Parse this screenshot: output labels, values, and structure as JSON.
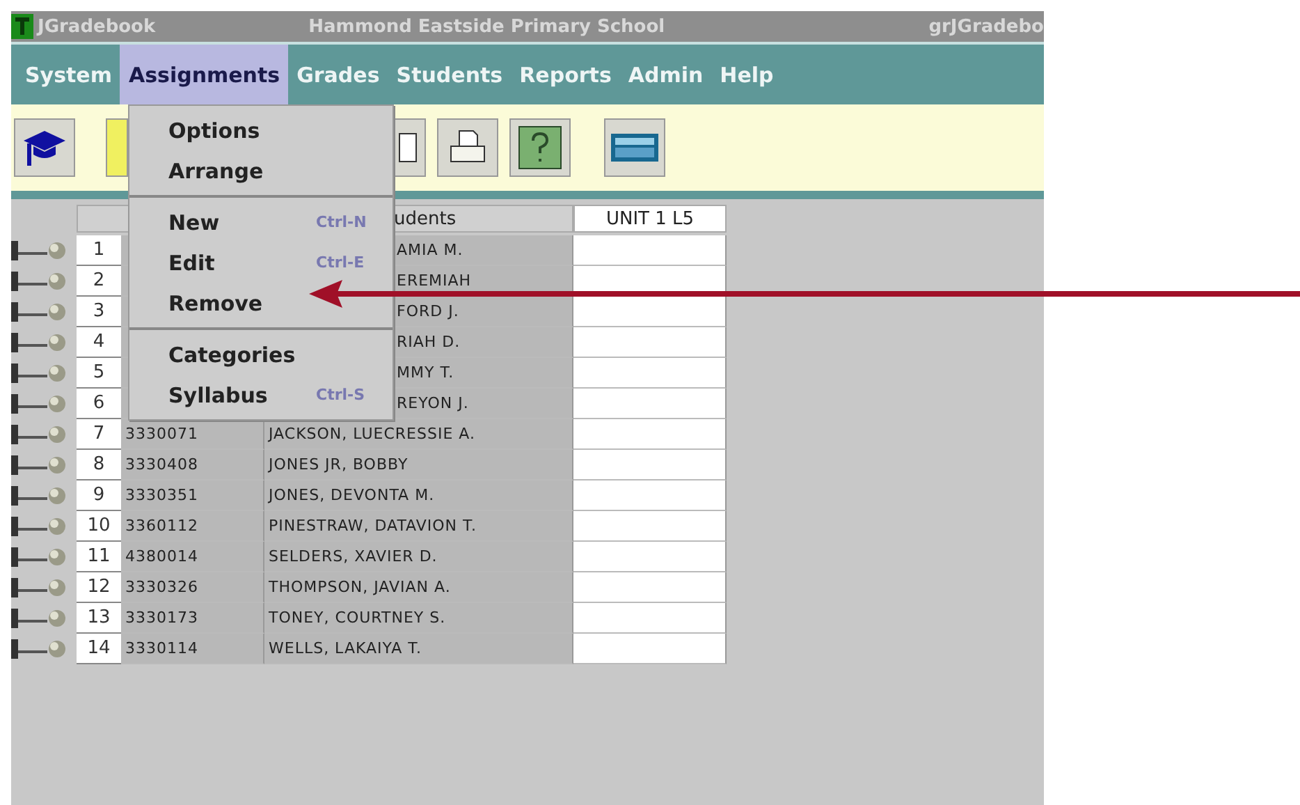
{
  "window": {
    "app_name": "JGradebook",
    "school": "Hammond Eastside Primary School",
    "right_title": "grJGradebo"
  },
  "menu": [
    {
      "label": "System",
      "selected": false
    },
    {
      "label": "Assignments",
      "selected": true
    },
    {
      "label": "Grades",
      "selected": false
    },
    {
      "label": "Students",
      "selected": false
    },
    {
      "label": "Reports",
      "selected": false
    },
    {
      "label": "Admin",
      "selected": false
    },
    {
      "label": "Help",
      "selected": false
    }
  ],
  "dropdown": {
    "groups": [
      [
        {
          "label": "Options"
        },
        {
          "label": "Arrange"
        }
      ],
      [
        {
          "label": "New",
          "shortcut": "Ctrl-N"
        },
        {
          "label": "Edit",
          "shortcut": "Ctrl-E"
        },
        {
          "label": "Remove"
        }
      ],
      [
        {
          "label": "Categories"
        },
        {
          "label": "Syllabus",
          "shortcut": "Ctrl-S"
        }
      ]
    ]
  },
  "table": {
    "name_header": "udents",
    "unit_header": "UNIT 1 L5",
    "rows": [
      {
        "number": "1",
        "name": "AMIA M."
      },
      {
        "number": "2",
        "name": "EREMIAH"
      },
      {
        "number": "3",
        "name": "FORD J."
      },
      {
        "number": "4",
        "name": "RIAH D."
      },
      {
        "number": "5",
        "name": "MMY T."
      },
      {
        "number": "6",
        "name": "REYON J."
      },
      {
        "number": "7",
        "id": "3330071",
        "name": "JACKSON, LUECRESSIE A."
      },
      {
        "number": "8",
        "id": "3330408",
        "name": "JONES JR, BOBBY"
      },
      {
        "number": "9",
        "id": "3330351",
        "name": "JONES, DEVONTA M."
      },
      {
        "number": "10",
        "id": "3360112",
        "name": "PINESTRAW, DATAVION T."
      },
      {
        "number": "11",
        "id": "4380014",
        "name": "SELDERS, XAVIER D."
      },
      {
        "number": "12",
        "id": "3330326",
        "name": "THOMPSON, JAVIAN A."
      },
      {
        "number": "13",
        "id": "3330173",
        "name": "TONEY, COURTNEY S."
      },
      {
        "number": "14",
        "id": "3330114",
        "name": "WELLS, LAKAIYA T."
      }
    ]
  }
}
